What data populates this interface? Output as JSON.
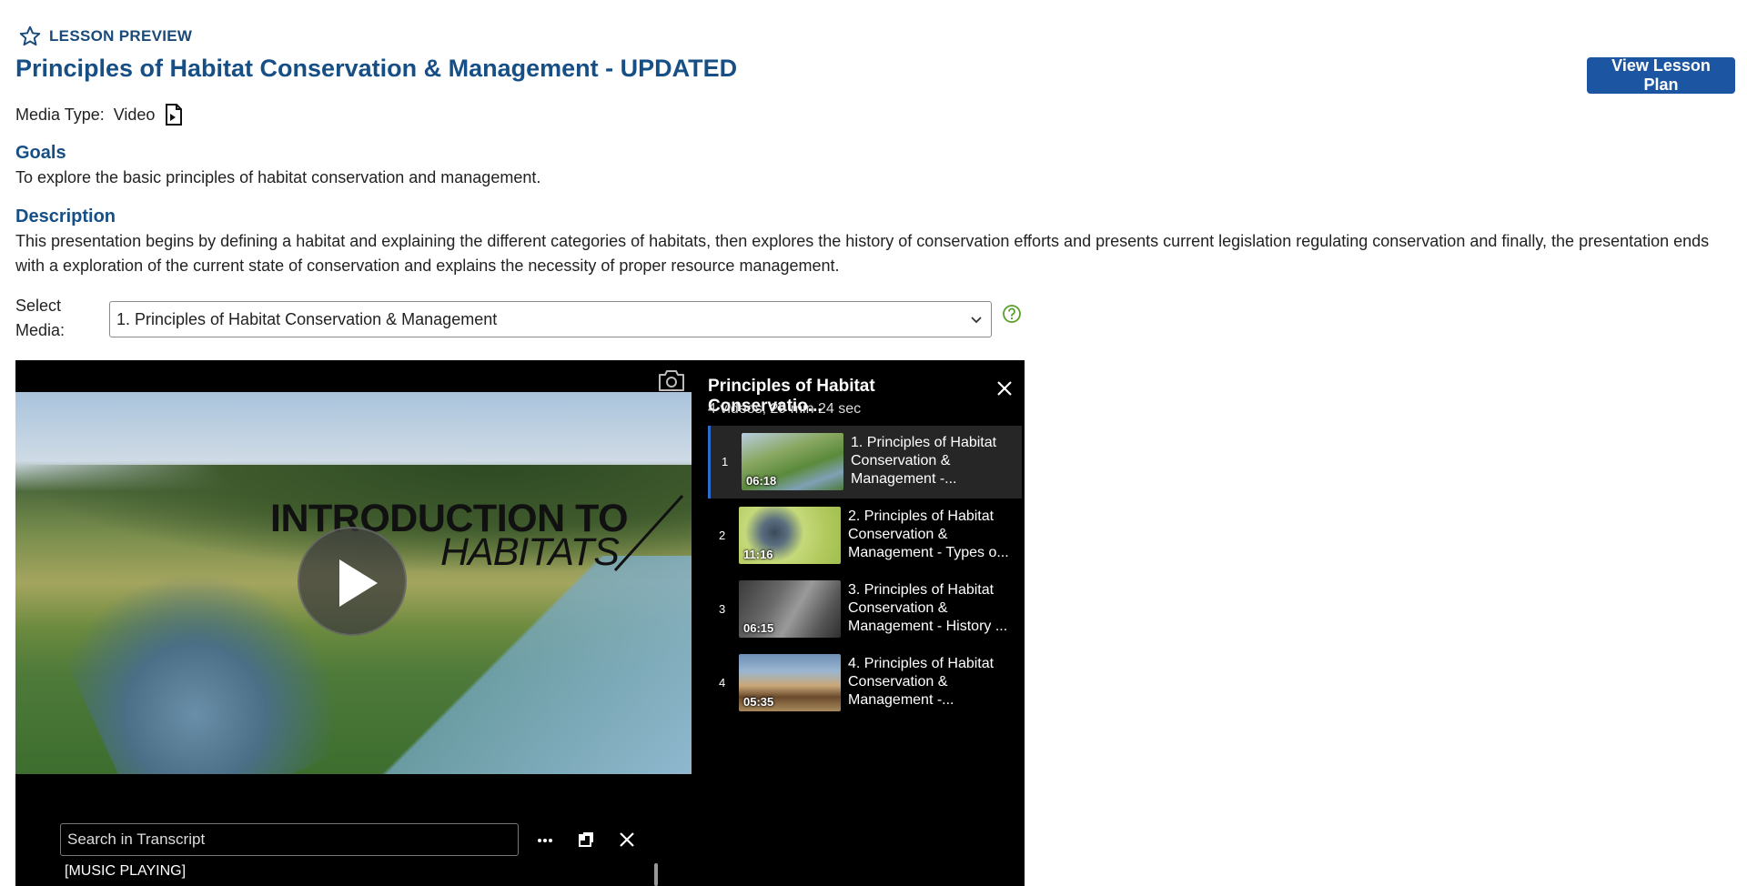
{
  "header": {
    "preview_label": "LESSON PREVIEW",
    "title": "Principles of Habitat Conservation & Management - UPDATED",
    "lesson_plan_button": "View Lesson Plan"
  },
  "media_type": {
    "label": "Media Type:",
    "value": "Video",
    "icon": "document-icon"
  },
  "goals": {
    "heading": "Goals",
    "text": "To explore the basic principles of habitat conservation and management."
  },
  "description": {
    "heading": "Description",
    "text": "This presentation begins by defining a habitat and explaining the different categories of habitats, then explores the history of conservation efforts and presents current legislation regulating conservation and finally, the presentation ends with a exploration of the current state of conservation and explains the necessity of proper resource management."
  },
  "select_media": {
    "label": "Select Media:",
    "selected": "1. Principles of Habitat Conservation & Management"
  },
  "player": {
    "video_title_line1": "INTRODUCTION TO",
    "video_title_line2": "HABITATS",
    "playlist": {
      "title": "Principles of Habitat Conservatio...",
      "meta": "4 videos, 29 min 24 sec",
      "items": [
        {
          "num": "1",
          "duration": "06:18",
          "label": "1. Principles of Habitat Conservation & Management -...",
          "active": true
        },
        {
          "num": "2",
          "duration": "11:16",
          "label": "2. Principles of Habitat Conservation & Management - Types o...",
          "active": false
        },
        {
          "num": "3",
          "duration": "06:15",
          "label": "3. Principles of Habitat Conservation & Management - History ...",
          "active": false
        },
        {
          "num": "4",
          "duration": "05:35",
          "label": "4. Principles of Habitat Conservation & Management -...",
          "active": false
        }
      ]
    },
    "transcript": {
      "search_placeholder": "Search in Transcript",
      "first_line": "[MUSIC PLAYING]"
    }
  },
  "colors": {
    "heading": "#164f86",
    "button": "#1c55a1",
    "help_icon": "#5aa02c",
    "active_item_border": "#2b6cd1"
  }
}
